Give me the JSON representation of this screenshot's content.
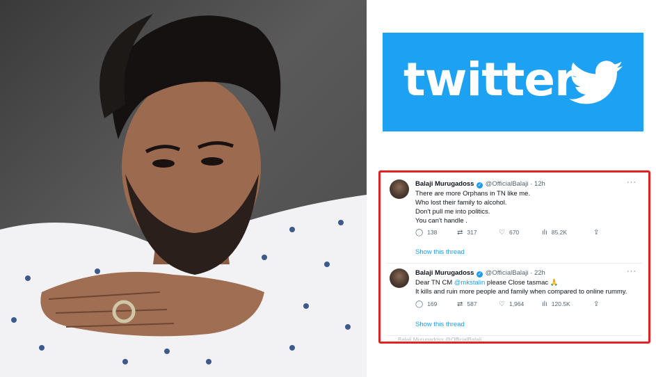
{
  "banner": {
    "wordmark": "twitter",
    "brand_color": "#1da1f2"
  },
  "photo": {
    "icon": "person-portrait"
  },
  "card_border_color": "#e02424",
  "tweets": [
    {
      "name": "Balaji Murugadoss",
      "handle": "@OfficialBalaji",
      "time": "· 12h",
      "lines": [
        "There are more Orphans in TN like me.",
        "Who lost their family to alcohol.",
        "Don't pull me into politics.",
        "You can't handle ."
      ],
      "replies": "138",
      "retweets": "317",
      "likes": "670",
      "views": "85.2K",
      "show_thread": "Show this thread"
    },
    {
      "name": "Balaji Murugadoss",
      "handle": "@OfficialBalaji",
      "time": "· 22h",
      "line1_pre": "Dear TN CM ",
      "mention": "@mkstalin",
      "line1_post": " please Close tasmac 🙏",
      "line2": "It kills and ruin more people and family when compared to online rummy.",
      "replies": "169",
      "retweets": "587",
      "likes": "1,964",
      "views": "120.5K",
      "show_thread": "Show this thread"
    }
  ],
  "next_tweet_hint": "Balaji Murugadoss @OfficialBalaji"
}
